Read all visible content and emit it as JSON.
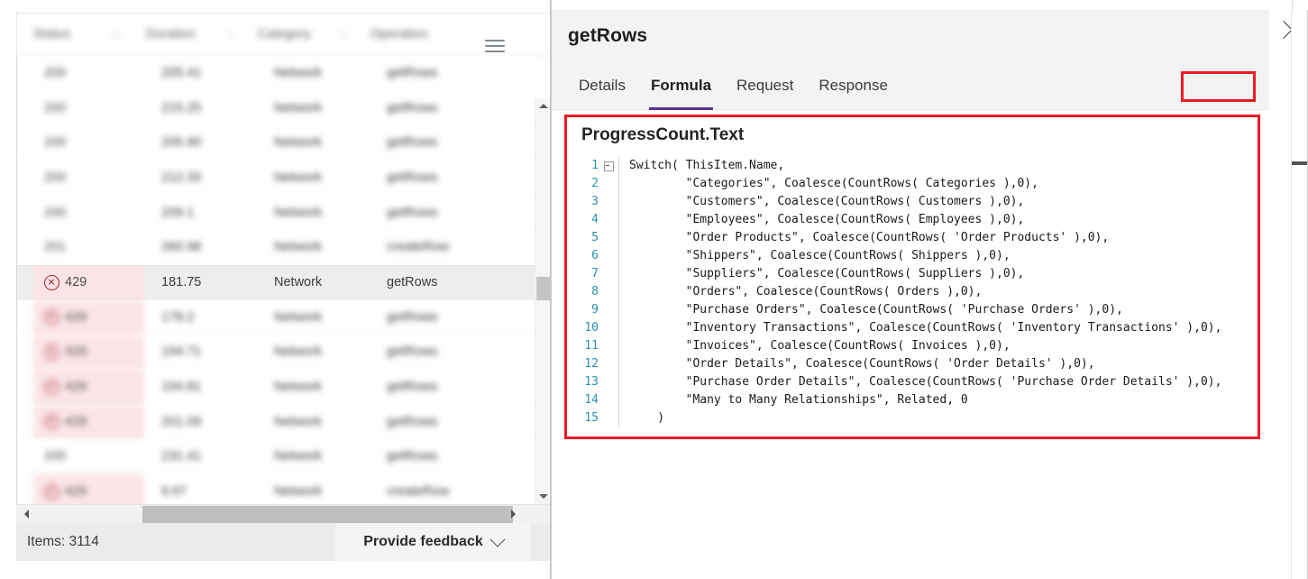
{
  "left_panel": {
    "table": {
      "columns": [
        "Status",
        "Duration",
        "Category",
        "Operation"
      ],
      "menu_icon": "hamburger-icon",
      "rows": [
        {
          "status": "200",
          "duration": "205.41",
          "category": "Network",
          "operation": "getRows",
          "error": false,
          "blurred": true,
          "selected": false
        },
        {
          "status": "200",
          "duration": "215.25",
          "category": "Network",
          "operation": "getRows",
          "error": false,
          "blurred": true,
          "selected": false
        },
        {
          "status": "200",
          "duration": "205.90",
          "category": "Network",
          "operation": "getRows",
          "error": false,
          "blurred": true,
          "selected": false
        },
        {
          "status": "200",
          "duration": "212.33",
          "category": "Network",
          "operation": "getRows",
          "error": false,
          "blurred": true,
          "selected": false
        },
        {
          "status": "200",
          "duration": "209.1",
          "category": "Network",
          "operation": "getRows",
          "error": false,
          "blurred": true,
          "selected": false
        },
        {
          "status": "201",
          "duration": "260.98",
          "category": "Network",
          "operation": "createRow",
          "error": false,
          "blurred": true,
          "selected": false
        },
        {
          "status": "429",
          "duration": "181.75",
          "category": "Network",
          "operation": "getRows",
          "error": true,
          "blurred": false,
          "selected": true
        },
        {
          "status": "429",
          "duration": "178.2",
          "category": "Network",
          "operation": "getRows",
          "error": true,
          "blurred": true,
          "selected": false
        },
        {
          "status": "429",
          "duration": "194.71",
          "category": "Network",
          "operation": "getRows",
          "error": true,
          "blurred": true,
          "selected": false
        },
        {
          "status": "429",
          "duration": "194.81",
          "category": "Network",
          "operation": "getRows",
          "error": true,
          "blurred": true,
          "selected": false
        },
        {
          "status": "429",
          "duration": "201.09",
          "category": "Network",
          "operation": "getRows",
          "error": true,
          "blurred": true,
          "selected": false
        },
        {
          "status": "200",
          "duration": "231.41",
          "category": "Network",
          "operation": "getRows",
          "error": false,
          "blurred": true,
          "selected": false
        },
        {
          "status": "429",
          "duration": "9.67",
          "category": "Network",
          "operation": "createRow",
          "error": true,
          "blurred": true,
          "selected": false
        }
      ]
    },
    "scrollbars": {
      "vertical_up_icon": "triangle-up-icon",
      "vertical_down_icon": "triangle-down-icon",
      "horizontal_left_icon": "triangle-left-icon",
      "horizontal_right_icon": "triangle-right-icon"
    },
    "footer": {
      "items_label": "Items: 3114",
      "feedback_label": "Provide feedback",
      "feedback_chevron_icon": "chevron-down-icon"
    }
  },
  "right_panel": {
    "title": "getRows",
    "collapse_icon": "chevron-right-icon",
    "tabs": [
      {
        "label": "Details",
        "active": false
      },
      {
        "label": "Formula",
        "active": true
      },
      {
        "label": "Request",
        "active": false
      },
      {
        "label": "Response",
        "active": false
      }
    ],
    "formula": {
      "property_label": "ProgressCount.Text",
      "lines": [
        {
          "n": "1",
          "text": "Switch( ThisItem.Name,"
        },
        {
          "n": "2",
          "text": "        \"Categories\", Coalesce(CountRows( Categories ),0),"
        },
        {
          "n": "3",
          "text": "        \"Customers\", Coalesce(CountRows( Customers ),0),"
        },
        {
          "n": "4",
          "text": "        \"Employees\", Coalesce(CountRows( Employees ),0),"
        },
        {
          "n": "5",
          "text": "        \"Order Products\", Coalesce(CountRows( 'Order Products' ),0),"
        },
        {
          "n": "6",
          "text": "        \"Shippers\", Coalesce(CountRows( Shippers ),0),"
        },
        {
          "n": "7",
          "text": "        \"Suppliers\", Coalesce(CountRows( Suppliers ),0),"
        },
        {
          "n": "8",
          "text": "        \"Orders\", Coalesce(CountRows( Orders ),0),"
        },
        {
          "n": "9",
          "text": "        \"Purchase Orders\", Coalesce(CountRows( 'Purchase Orders' ),0),"
        },
        {
          "n": "10",
          "text": "        \"Inventory Transactions\", Coalesce(CountRows( 'Inventory Transactions' ),0),"
        },
        {
          "n": "11",
          "text": "        \"Invoices\", Coalesce(CountRows( Invoices ),0),"
        },
        {
          "n": "12",
          "text": "        \"Order Details\", Coalesce(CountRows( 'Order Details' ),0),"
        },
        {
          "n": "13",
          "text": "        \"Purchase Order Details\", Coalesce(CountRows( 'Purchase Order Details' ),0),"
        },
        {
          "n": "14",
          "text": "        \"Many to Many Relationships\", Related, 0"
        },
        {
          "n": "15",
          "text": "    )"
        }
      ]
    }
  },
  "colors": {
    "annotation_red": "#ed1c24",
    "tab_accent_purple": "#5b2d8e",
    "error_row_pink": "#fbe4e7",
    "error_icon_red": "#a4262c",
    "selected_row_gray": "#ededed",
    "code_linenumber_blue": "#2b91af"
  }
}
